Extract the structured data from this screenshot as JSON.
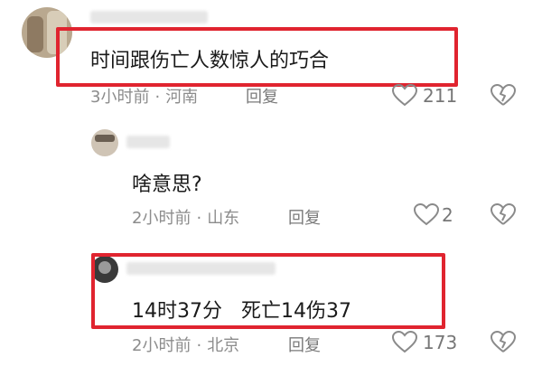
{
  "colors": {
    "highlight": "#e0242f",
    "meta": "#8c8c8c",
    "text": "#1a1a1a",
    "icon": "#8a8a8a"
  },
  "comments": [
    {
      "content": "时间跟伤亡人数惊人的巧合",
      "time": "3小时前",
      "separator": "·",
      "location": "河南",
      "reply": "回复",
      "likes": "211",
      "highlighted": true
    },
    {
      "content": "啥意思?",
      "time": "2小时前",
      "separator": "·",
      "location": "山东",
      "reply": "回复",
      "likes": "2",
      "highlighted": false
    },
    {
      "content": "14时37分   死亡14伤37",
      "time": "2小时前",
      "separator": "·",
      "location": "北京",
      "reply": "回复",
      "likes": "173",
      "highlighted": true
    }
  ],
  "icons": {
    "like": "heart-outline-icon",
    "dislike": "broken-heart-icon"
  }
}
